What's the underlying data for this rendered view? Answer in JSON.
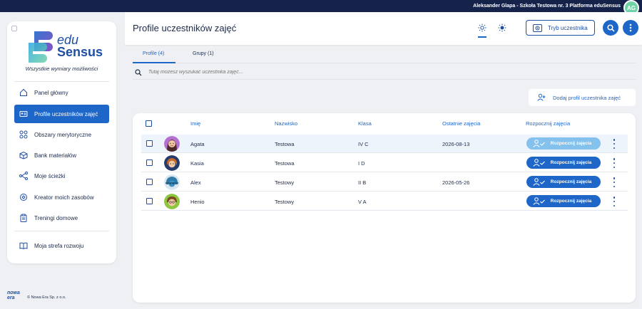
{
  "topbar": {
    "user_info": "Aleksander Glapa - Szkoła Testowa nr. 3 Platforma eduSensus",
    "avatar_initials": "AG"
  },
  "sidebar": {
    "logo": {
      "line1": "edu",
      "line2": "Sensus"
    },
    "tagline": "Wszystkie wymiary możliwości",
    "items": [
      {
        "label": "Panel główny",
        "icon": "home-icon"
      },
      {
        "label": "Profile uczestników zajęć",
        "icon": "id-card-icon",
        "active": true
      },
      {
        "label": "Obszary merytoryczne",
        "icon": "grid-icon"
      },
      {
        "label": "Bank materiałów",
        "icon": "box-icon"
      },
      {
        "label": "Moje ścieżki",
        "icon": "paths-icon"
      },
      {
        "label": "Kreator moich zasobów",
        "icon": "wand-icon"
      },
      {
        "label": "Treningi domowe",
        "icon": "clipboard-icon"
      },
      {
        "label": "Moja strefa rozwoju",
        "icon": "book-icon"
      }
    ],
    "footer": {
      "brand": "nowa era",
      "copyright": "© Nowa Era Sp. z o.o."
    }
  },
  "header": {
    "title": "Profile uczestników zajęć",
    "mode_button": "Tryb uczestnika"
  },
  "tabs": [
    {
      "label": "Profile (4)",
      "active": true
    },
    {
      "label": "Grupy (1)",
      "active": false
    }
  ],
  "search": {
    "placeholder": "Tutaj możesz wyszukać uczestnika zajęć..."
  },
  "add_button": "Dodaj profil uczestnika zajęć",
  "table": {
    "headers": {
      "first_name": "Imię",
      "last_name": "Nazwisko",
      "class": "Klasa",
      "last_session": "Ostatnie zajęcia",
      "start": "Rozpocznij zajęcia"
    },
    "start_label": "Rozpocznij zajęcia",
    "rows": [
      {
        "first_name": "Agata",
        "last_name": "Testowa",
        "class": "IV C",
        "last_session": "2026-08-13"
      },
      {
        "first_name": "Kasia",
        "last_name": "Testowa",
        "class": "I D",
        "last_session": ""
      },
      {
        "first_name": "Alex",
        "last_name": "Testowy",
        "class": "II B",
        "last_session": "2026-05-26"
      },
      {
        "first_name": "Henio",
        "last_name": "Testowy",
        "class": "V A",
        "last_session": ""
      }
    ]
  },
  "colors": {
    "primary": "#1e66c7",
    "navy": "#15234a",
    "accent_green": "#6fd3a6"
  }
}
